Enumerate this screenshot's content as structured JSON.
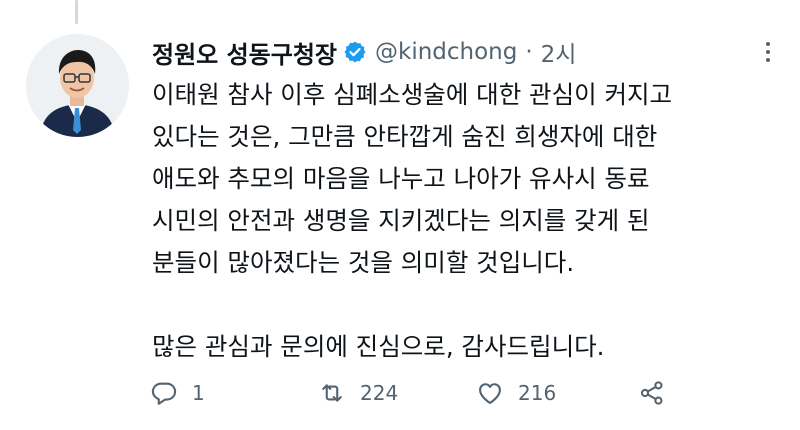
{
  "tweet": {
    "author_name": "정원오 성동구청장",
    "handle": "@kindchong",
    "separator": "·",
    "time": "2시",
    "body_lines": [
      "이태원 참사 이후 심폐소생술에 대한 관심이 커지고",
      "있다는 것은, 그만큼 안타깝게 숨진 희생자에 대한",
      "애도와 추모의 마음을 나누고 나아가 유사시 동료",
      "시민의 안전과 생명을 지키겠다는 의지를 갖게 된",
      "분들이 많아졌다는 것을 의미할 것입니다.",
      "많은 관심과 문의에 진심으로, 감사드립니다."
    ]
  },
  "actions": {
    "reply_count": "1",
    "retweet_count": "224",
    "like_count": "216"
  },
  "icons": {
    "verified": "verified-badge-icon",
    "more": "more-dots-icon",
    "reply": "reply-icon",
    "retweet": "retweet-icon",
    "like": "heart-icon",
    "share": "share-icon"
  },
  "colors": {
    "verified_blue": "#1d9bf0",
    "secondary_text": "#536471",
    "primary_text": "#0f1419"
  }
}
